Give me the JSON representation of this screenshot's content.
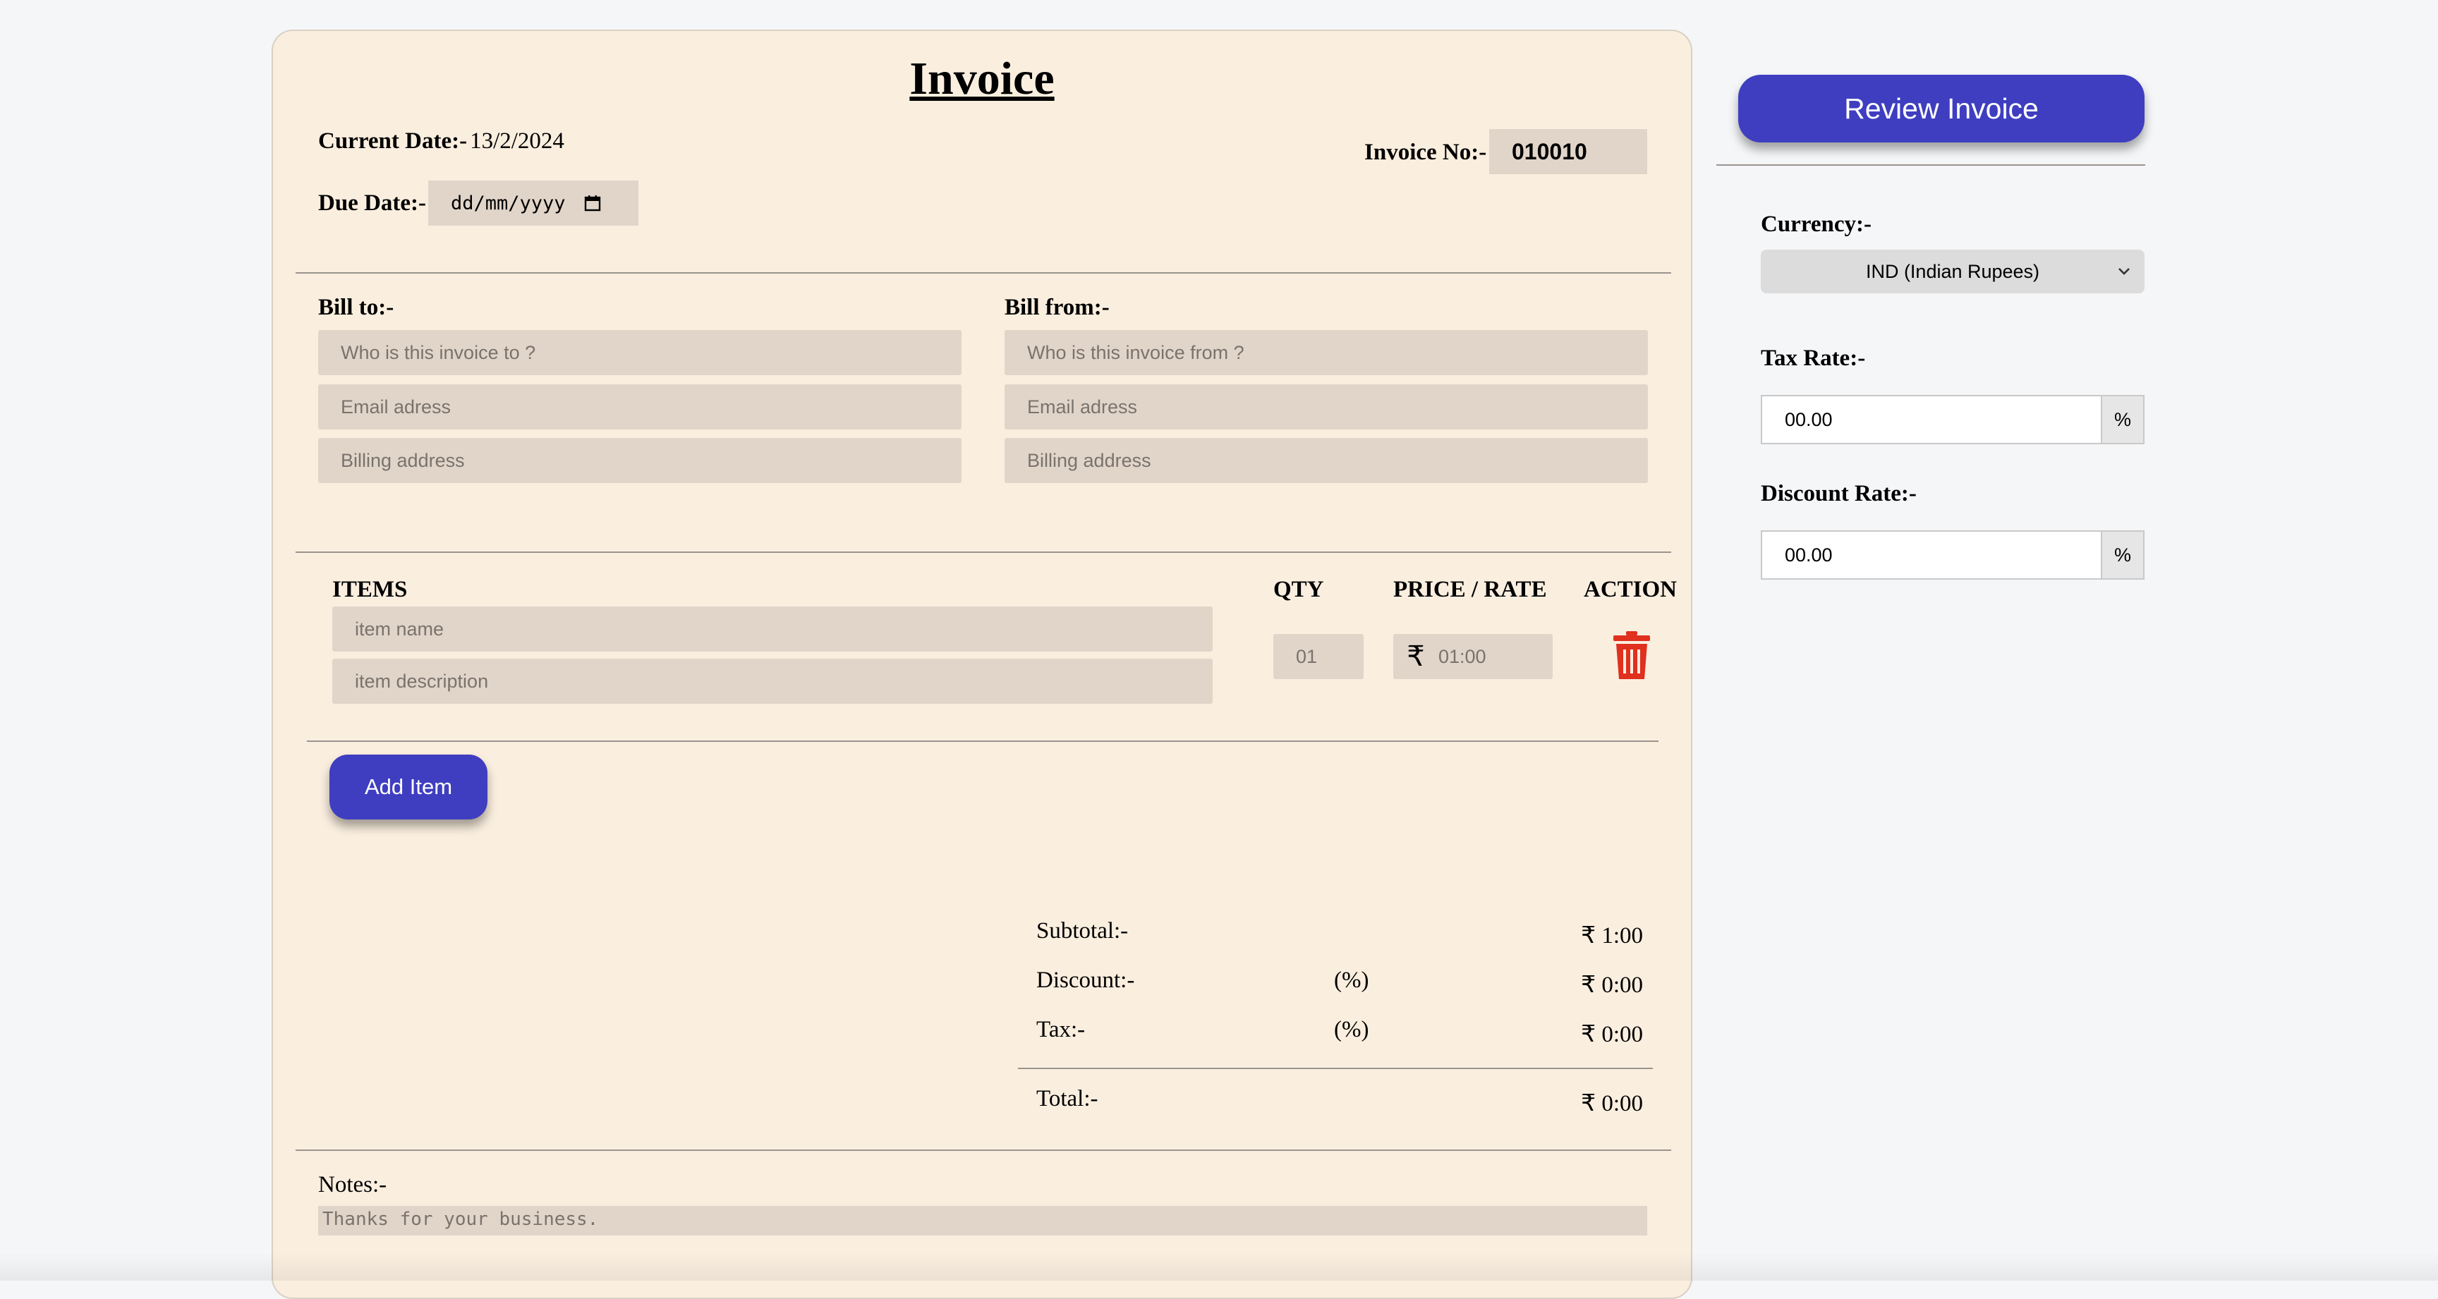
{
  "invoice": {
    "title": "Invoice",
    "current_date_label": "Current Date:-",
    "current_date_value": "13/2/2024",
    "invoice_no_label": "Invoice No:-",
    "invoice_no_value": "010010",
    "due_date_label": "Due Date:-",
    "due_date_placeholder": "dd/mm/yyyy",
    "bill_to": {
      "label": "Bill to:-",
      "name_placeholder": "Who is this invoice to ?",
      "email_placeholder": "Email adress",
      "address_placeholder": "Billing address"
    },
    "bill_from": {
      "label": "Bill from:-",
      "name_placeholder": "Who is this invoice from ?",
      "email_placeholder": "Email adress",
      "address_placeholder": "Billing address"
    },
    "items_table": {
      "headers": [
        "ITEMS",
        "QTY",
        "PRICE / RATE",
        "ACTION"
      ],
      "row": {
        "name_placeholder": "item name",
        "description_placeholder": "item description",
        "qty_placeholder": "01",
        "currency_symbol": "₹",
        "price_placeholder": "01:00"
      }
    },
    "add_item_label": "Add Item",
    "totals": {
      "subtotal_label": "Subtotal:-",
      "subtotal_value": "₹ 1:00",
      "discount_label": "Discount:-",
      "discount_pct": "(%)",
      "discount_value": "₹ 0:00",
      "tax_label": "Tax:-",
      "tax_pct": "(%)",
      "tax_value": "₹ 0:00",
      "total_label": "Total:-",
      "total_value": "₹ 0:00"
    },
    "notes_label": "Notes:-",
    "notes_placeholder": "Thanks for your business."
  },
  "sidebar": {
    "review_button": "Review Invoice",
    "currency_label": "Currency:-",
    "currency_value": "IND (Indian Rupees)",
    "tax_rate_label": "Tax Rate:-",
    "tax_rate_value": "00.00",
    "discount_rate_label": "Discount Rate:-",
    "discount_rate_value": "00.00",
    "percent_symbol": "%"
  },
  "colors": {
    "accent": "#3f3ec0",
    "card_bg": "#faeedf",
    "field_bg": "#e1d5ca",
    "delete": "#e0301e"
  }
}
